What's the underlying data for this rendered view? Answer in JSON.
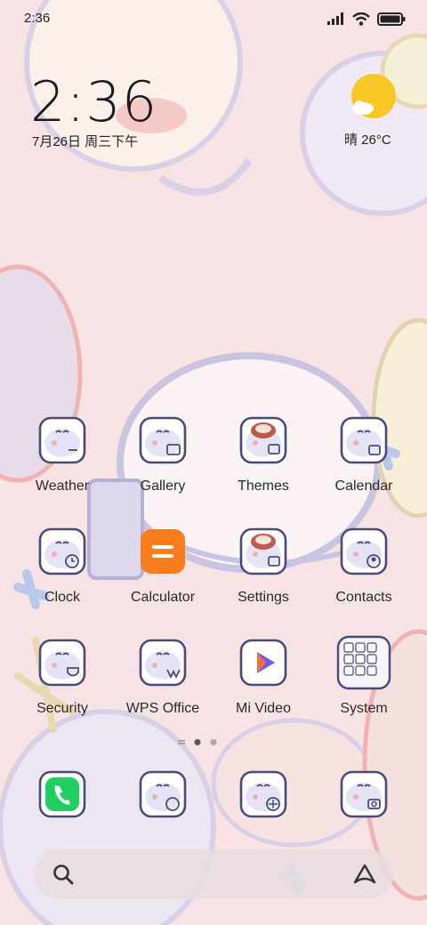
{
  "status_bar": {
    "time": "2:36"
  },
  "clock_widget": {
    "time": "2:36",
    "date": "7月26日 周三下午"
  },
  "weather_widget": {
    "text": "晴 26°C",
    "icon": "sun-cloud-icon"
  },
  "apps": [
    {
      "label": "Weather",
      "icon": "weather-app-icon"
    },
    {
      "label": "Gallery",
      "icon": "gallery-app-icon"
    },
    {
      "label": "Themes",
      "icon": "themes-app-icon"
    },
    {
      "label": "Calendar",
      "icon": "calendar-app-icon"
    },
    {
      "label": "Clock",
      "icon": "clock-app-icon"
    },
    {
      "label": "Calculator",
      "icon": "calculator-app-icon"
    },
    {
      "label": "Settings",
      "icon": "settings-app-icon"
    },
    {
      "label": "Contacts",
      "icon": "contacts-app-icon"
    },
    {
      "label": "Security",
      "icon": "security-app-icon"
    },
    {
      "label": "WPS Office",
      "icon": "wps-office-app-icon"
    },
    {
      "label": "Mi Video",
      "icon": "mi-video-app-icon"
    },
    {
      "label": "System",
      "icon": "system-folder-icon"
    }
  ],
  "page_indicator": {
    "pages": 2,
    "current": 1
  },
  "dock": [
    {
      "icon": "phone-app-icon"
    },
    {
      "icon": "messages-app-icon"
    },
    {
      "icon": "browser-app-icon"
    },
    {
      "icon": "camera-app-icon"
    }
  ],
  "search_bar": {
    "left_icon": "search-icon",
    "right_icon": "assistant-icon"
  },
  "colors": {
    "wallpaper": "#f7e3e3",
    "icon_outline": "#4a4a7a",
    "phone_green": "#1fcf62",
    "calculator_orange": "#f97d1f",
    "weather_sun": "#f8c625"
  }
}
